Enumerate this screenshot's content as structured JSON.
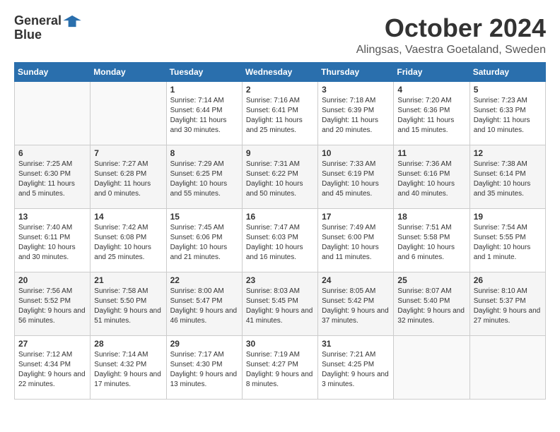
{
  "logo": {
    "general": "General",
    "blue": "Blue"
  },
  "title": "October 2024",
  "location": "Alingsas, Vaestra Goetaland, Sweden",
  "days_header": [
    "Sunday",
    "Monday",
    "Tuesday",
    "Wednesday",
    "Thursday",
    "Friday",
    "Saturday"
  ],
  "weeks": [
    [
      {
        "day": "",
        "sunrise": "",
        "sunset": "",
        "daylight": ""
      },
      {
        "day": "",
        "sunrise": "",
        "sunset": "",
        "daylight": ""
      },
      {
        "day": "1",
        "sunrise": "Sunrise: 7:14 AM",
        "sunset": "Sunset: 6:44 PM",
        "daylight": "Daylight: 11 hours and 30 minutes."
      },
      {
        "day": "2",
        "sunrise": "Sunrise: 7:16 AM",
        "sunset": "Sunset: 6:41 PM",
        "daylight": "Daylight: 11 hours and 25 minutes."
      },
      {
        "day": "3",
        "sunrise": "Sunrise: 7:18 AM",
        "sunset": "Sunset: 6:39 PM",
        "daylight": "Daylight: 11 hours and 20 minutes."
      },
      {
        "day": "4",
        "sunrise": "Sunrise: 7:20 AM",
        "sunset": "Sunset: 6:36 PM",
        "daylight": "Daylight: 11 hours and 15 minutes."
      },
      {
        "day": "5",
        "sunrise": "Sunrise: 7:23 AM",
        "sunset": "Sunset: 6:33 PM",
        "daylight": "Daylight: 11 hours and 10 minutes."
      }
    ],
    [
      {
        "day": "6",
        "sunrise": "Sunrise: 7:25 AM",
        "sunset": "Sunset: 6:30 PM",
        "daylight": "Daylight: 11 hours and 5 minutes."
      },
      {
        "day": "7",
        "sunrise": "Sunrise: 7:27 AM",
        "sunset": "Sunset: 6:28 PM",
        "daylight": "Daylight: 11 hours and 0 minutes."
      },
      {
        "day": "8",
        "sunrise": "Sunrise: 7:29 AM",
        "sunset": "Sunset: 6:25 PM",
        "daylight": "Daylight: 10 hours and 55 minutes."
      },
      {
        "day": "9",
        "sunrise": "Sunrise: 7:31 AM",
        "sunset": "Sunset: 6:22 PM",
        "daylight": "Daylight: 10 hours and 50 minutes."
      },
      {
        "day": "10",
        "sunrise": "Sunrise: 7:33 AM",
        "sunset": "Sunset: 6:19 PM",
        "daylight": "Daylight: 10 hours and 45 minutes."
      },
      {
        "day": "11",
        "sunrise": "Sunrise: 7:36 AM",
        "sunset": "Sunset: 6:16 PM",
        "daylight": "Daylight: 10 hours and 40 minutes."
      },
      {
        "day": "12",
        "sunrise": "Sunrise: 7:38 AM",
        "sunset": "Sunset: 6:14 PM",
        "daylight": "Daylight: 10 hours and 35 minutes."
      }
    ],
    [
      {
        "day": "13",
        "sunrise": "Sunrise: 7:40 AM",
        "sunset": "Sunset: 6:11 PM",
        "daylight": "Daylight: 10 hours and 30 minutes."
      },
      {
        "day": "14",
        "sunrise": "Sunrise: 7:42 AM",
        "sunset": "Sunset: 6:08 PM",
        "daylight": "Daylight: 10 hours and 25 minutes."
      },
      {
        "day": "15",
        "sunrise": "Sunrise: 7:45 AM",
        "sunset": "Sunset: 6:06 PM",
        "daylight": "Daylight: 10 hours and 21 minutes."
      },
      {
        "day": "16",
        "sunrise": "Sunrise: 7:47 AM",
        "sunset": "Sunset: 6:03 PM",
        "daylight": "Daylight: 10 hours and 16 minutes."
      },
      {
        "day": "17",
        "sunrise": "Sunrise: 7:49 AM",
        "sunset": "Sunset: 6:00 PM",
        "daylight": "Daylight: 10 hours and 11 minutes."
      },
      {
        "day": "18",
        "sunrise": "Sunrise: 7:51 AM",
        "sunset": "Sunset: 5:58 PM",
        "daylight": "Daylight: 10 hours and 6 minutes."
      },
      {
        "day": "19",
        "sunrise": "Sunrise: 7:54 AM",
        "sunset": "Sunset: 5:55 PM",
        "daylight": "Daylight: 10 hours and 1 minute."
      }
    ],
    [
      {
        "day": "20",
        "sunrise": "Sunrise: 7:56 AM",
        "sunset": "Sunset: 5:52 PM",
        "daylight": "Daylight: 9 hours and 56 minutes."
      },
      {
        "day": "21",
        "sunrise": "Sunrise: 7:58 AM",
        "sunset": "Sunset: 5:50 PM",
        "daylight": "Daylight: 9 hours and 51 minutes."
      },
      {
        "day": "22",
        "sunrise": "Sunrise: 8:00 AM",
        "sunset": "Sunset: 5:47 PM",
        "daylight": "Daylight: 9 hours and 46 minutes."
      },
      {
        "day": "23",
        "sunrise": "Sunrise: 8:03 AM",
        "sunset": "Sunset: 5:45 PM",
        "daylight": "Daylight: 9 hours and 41 minutes."
      },
      {
        "day": "24",
        "sunrise": "Sunrise: 8:05 AM",
        "sunset": "Sunset: 5:42 PM",
        "daylight": "Daylight: 9 hours and 37 minutes."
      },
      {
        "day": "25",
        "sunrise": "Sunrise: 8:07 AM",
        "sunset": "Sunset: 5:40 PM",
        "daylight": "Daylight: 9 hours and 32 minutes."
      },
      {
        "day": "26",
        "sunrise": "Sunrise: 8:10 AM",
        "sunset": "Sunset: 5:37 PM",
        "daylight": "Daylight: 9 hours and 27 minutes."
      }
    ],
    [
      {
        "day": "27",
        "sunrise": "Sunrise: 7:12 AM",
        "sunset": "Sunset: 4:34 PM",
        "daylight": "Daylight: 9 hours and 22 minutes."
      },
      {
        "day": "28",
        "sunrise": "Sunrise: 7:14 AM",
        "sunset": "Sunset: 4:32 PM",
        "daylight": "Daylight: 9 hours and 17 minutes."
      },
      {
        "day": "29",
        "sunrise": "Sunrise: 7:17 AM",
        "sunset": "Sunset: 4:30 PM",
        "daylight": "Daylight: 9 hours and 13 minutes."
      },
      {
        "day": "30",
        "sunrise": "Sunrise: 7:19 AM",
        "sunset": "Sunset: 4:27 PM",
        "daylight": "Daylight: 9 hours and 8 minutes."
      },
      {
        "day": "31",
        "sunrise": "Sunrise: 7:21 AM",
        "sunset": "Sunset: 4:25 PM",
        "daylight": "Daylight: 9 hours and 3 minutes."
      },
      {
        "day": "",
        "sunrise": "",
        "sunset": "",
        "daylight": ""
      },
      {
        "day": "",
        "sunrise": "",
        "sunset": "",
        "daylight": ""
      }
    ]
  ]
}
